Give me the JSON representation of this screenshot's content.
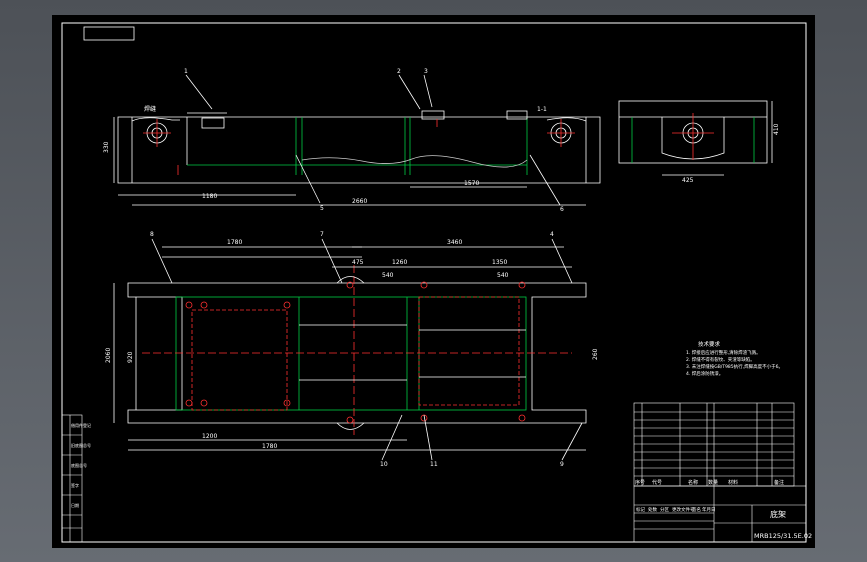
{
  "drawing": {
    "title": "底架",
    "drawing_number": "MRB125/31.5E.02"
  },
  "callouts": [
    "1",
    "2",
    "3",
    "4",
    "5",
    "6",
    "7",
    "8",
    "9",
    "10",
    "11"
  ],
  "top_view": {
    "dims": [
      "1180",
      "2660",
      "1570",
      "330"
    ],
    "labels": [
      "焊缝",
      "1-1"
    ]
  },
  "side_view": {
    "dims": [
      "425",
      "410"
    ]
  },
  "plan_view": {
    "dims_top": [
      "1780",
      "3460",
      "475",
      "1260",
      "1350",
      "540",
      "540"
    ],
    "dims_bottom": [
      "1200",
      "1780"
    ],
    "dims_side": [
      "2060",
      "920",
      "260"
    ]
  },
  "notes": {
    "heading": "技术要求",
    "lines": [
      "1. 焊接后应进行整形,清除焊渣飞溅。",
      "2. 焊缝不得有裂纹、夹渣等缺陷。",
      "3. 未注焊缝按GB/T985执行,焊脚高度不小于6。",
      "4. 焊后涂防锈漆。"
    ]
  },
  "title_block": {
    "header": [
      "序号",
      "代号",
      "名称",
      "数量",
      "材料",
      "备注"
    ],
    "revision_labels": [
      "标记",
      "处数",
      "分区",
      "更改文件号",
      "签名",
      "年月日"
    ],
    "left_strip": [
      "借用件登记",
      "旧底图总号",
      "底图总号",
      "签字",
      "日期"
    ]
  }
}
